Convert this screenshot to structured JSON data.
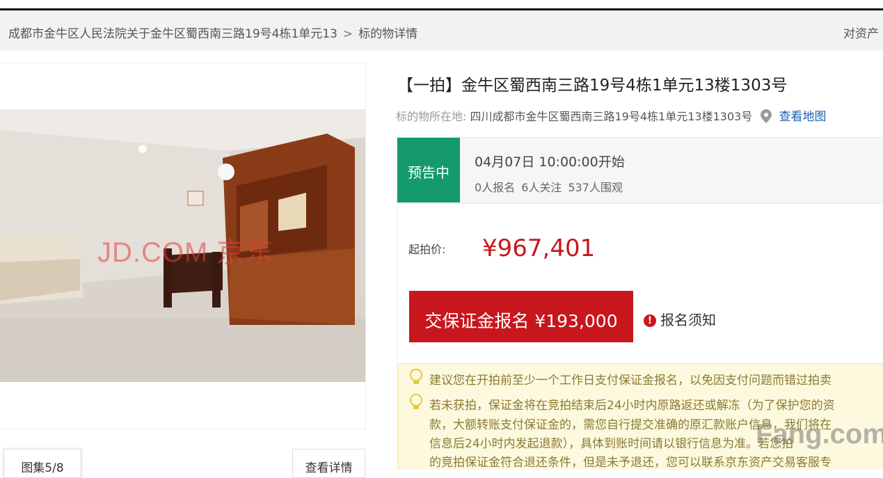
{
  "breadcrumb": {
    "parent": "成都市金牛区人民法院关于金牛区蜀西南三路19号4栋1单元13",
    "separator": ">",
    "current": "标的物详情"
  },
  "top_right_text": "对资产",
  "gallery": {
    "watermark": "JD.COM 京东",
    "counter": "图集5/8",
    "detail_button": "查看详情"
  },
  "item": {
    "title": "【一拍】金牛区蜀西南三路19号4栋1单元13楼1303号",
    "location_label": "标的物所在地:",
    "location_value": "四川成都市金牛区蜀西南三路19号4栋1单元13楼1303号",
    "map_link": "查看地图"
  },
  "status": {
    "badge": "预告中",
    "start_time": "04月07日 10:00:00开始",
    "registrations": "0人报名",
    "followers": "6人关注",
    "viewers": "537人围观"
  },
  "pricing": {
    "start_price_label": "起拍价:",
    "start_price": "¥967,401",
    "deposit_button": "交保证金报名 ¥193,000",
    "notice_link": "报名须知"
  },
  "tips": [
    "建议您在开拍前至少一个工作日支付保证金报名，以免因支付问题而错过拍卖",
    "若未获拍，保证金将在竞拍结束后24小时内原路返还或解冻（为了保护您的资",
    "款，大额转账支付保证金的，需您自行提交准确的原汇款账户信息，我们将在",
    "信息后24小时内发起退款），具体到账时间请以银行信息为准。若您拍",
    "的竞拍保证金符合退还条件，但是未予退还，您可以联系京东资产交易客服专"
  ],
  "colors": {
    "accent_red": "#c8161d",
    "status_green": "#149a6b",
    "link_blue": "#1a5fb4",
    "tip_background": "#fdf9df"
  },
  "icons": [
    "location-pin-icon",
    "exclamation-icon",
    "lightbulb-icon"
  ]
}
